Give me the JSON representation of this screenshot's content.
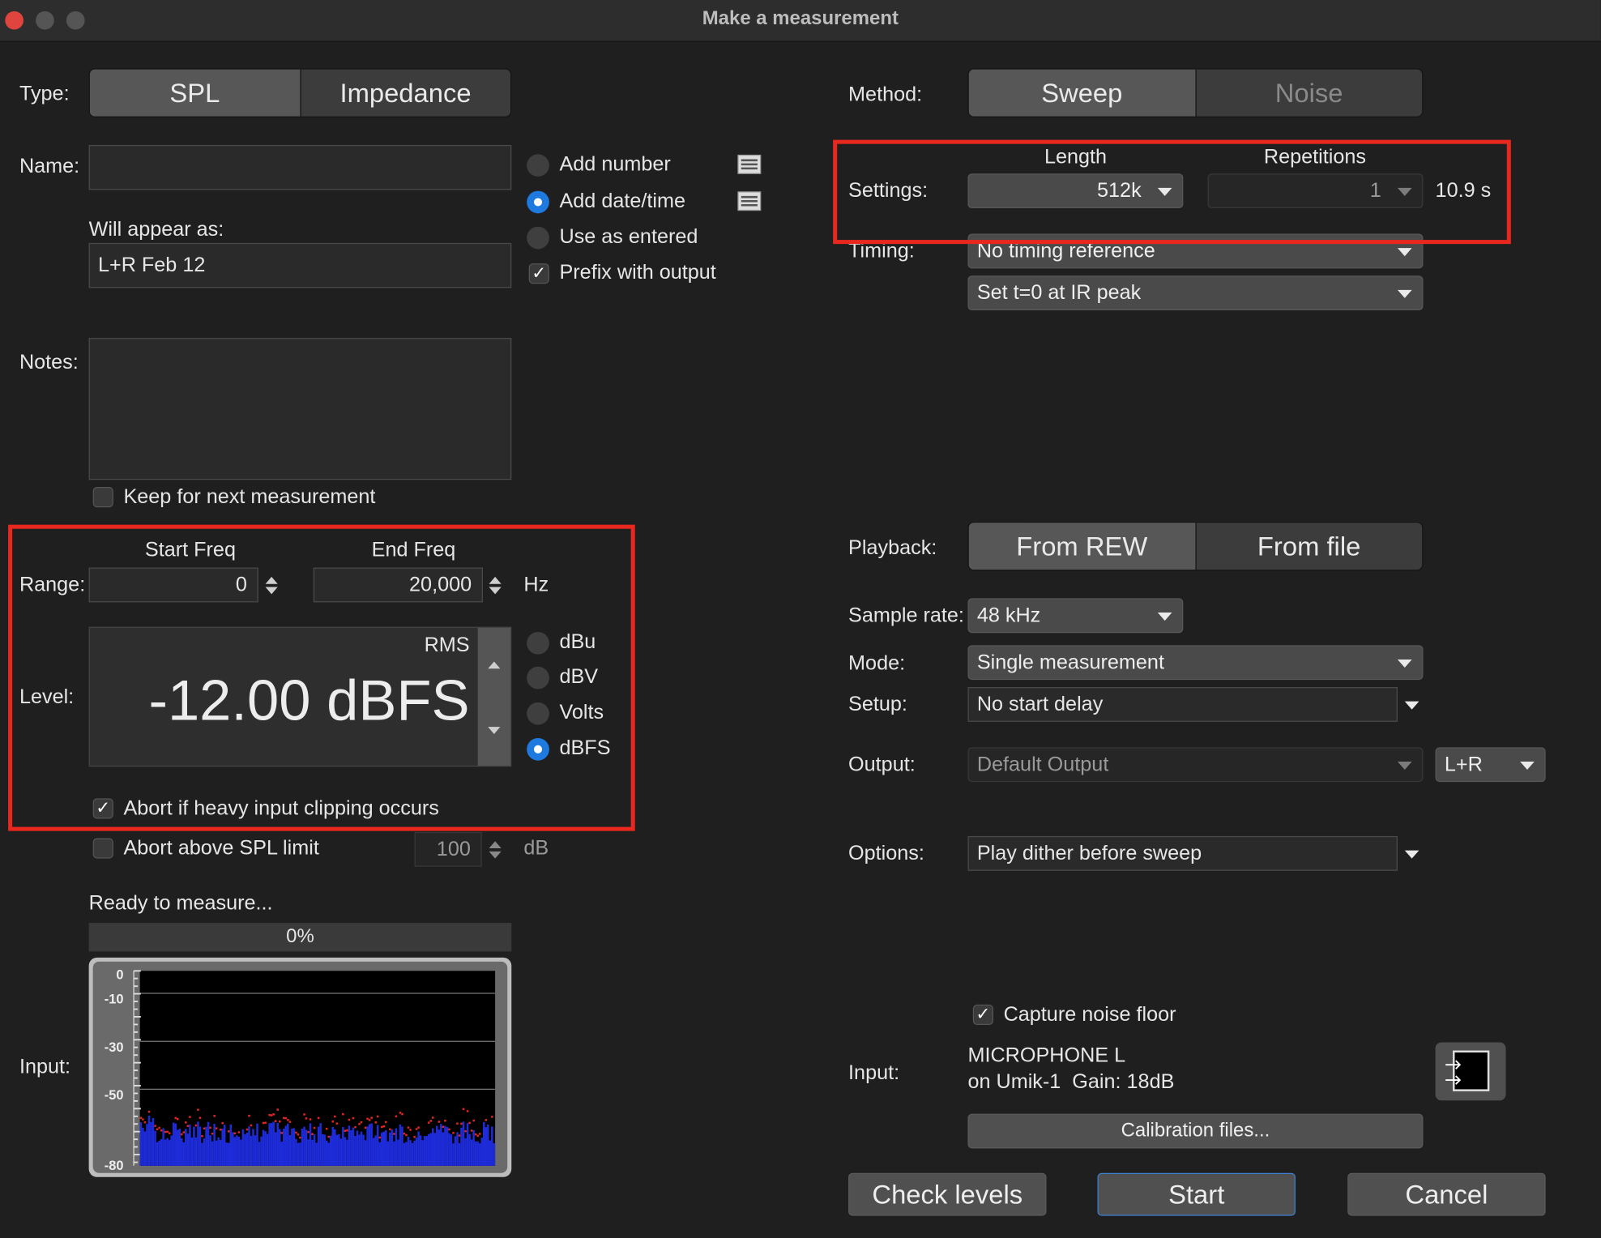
{
  "window": {
    "title": "Make a measurement"
  },
  "type": {
    "label": "Type:",
    "options": [
      "SPL",
      "Impedance"
    ],
    "selected": "SPL"
  },
  "name": {
    "label": "Name:",
    "value": "",
    "appear_label": "Will appear as:",
    "appear_value": "L+R Feb 12"
  },
  "naming_options": [
    "Add number",
    "Add date/time",
    "Use as entered",
    "Prefix with output"
  ],
  "naming_selected": "Add date/time",
  "notes": {
    "label": "Notes:",
    "value": "",
    "keep_label": "Keep for next measurement"
  },
  "range": {
    "label": "Range:",
    "start_label": "Start Freq",
    "end_label": "End Freq",
    "start": "0",
    "end": "20,000",
    "unit": "Hz"
  },
  "level": {
    "label": "Level:",
    "mode": "RMS",
    "value": "-12.00 dBFS",
    "units": [
      "dBu",
      "dBV",
      "Volts",
      "dBFS"
    ],
    "selected_unit": "dBFS"
  },
  "abort_clipping": {
    "label": "Abort if heavy input clipping occurs",
    "checked": true
  },
  "abort_spl": {
    "label": "Abort above SPL limit",
    "checked": false,
    "value": "100",
    "unit": "dB"
  },
  "status": {
    "text": "Ready to measure...",
    "progress": "0%"
  },
  "input_meter": {
    "label": "Input:",
    "ticks": [
      "0",
      "-10",
      "-30",
      "-50",
      "-80"
    ]
  },
  "method": {
    "label": "Method:",
    "options": [
      "Sweep",
      "Noise"
    ],
    "selected": "Sweep"
  },
  "settings": {
    "label": "Settings:",
    "length_label": "Length",
    "length": "512k",
    "reps_label": "Repetitions",
    "reps": "1",
    "duration": "10.9 s"
  },
  "timing": {
    "label": "Timing:",
    "reference": "No timing reference",
    "ir_peak": "Set t=0 at IR peak"
  },
  "playback": {
    "label": "Playback:",
    "options": [
      "From REW",
      "From file"
    ],
    "selected": "From REW"
  },
  "sample_rate": {
    "label": "Sample rate:",
    "value": "48 kHz"
  },
  "mode": {
    "label": "Mode:",
    "value": "Single measurement"
  },
  "setup": {
    "label": "Setup:",
    "value": "No start delay"
  },
  "output": {
    "label": "Output:",
    "device": "Default Output",
    "channel": "L+R"
  },
  "options": {
    "label": "Options:",
    "value": "Play dither before sweep"
  },
  "capture_noise": {
    "label": "Capture noise floor",
    "checked": true
  },
  "input_device": {
    "label": "Input:",
    "line1": "MICROPHONE L",
    "line2": "on Umik-1  Gain: 18dB"
  },
  "buttons": {
    "calibration": "Calibration files...",
    "check_levels": "Check levels",
    "start": "Start",
    "cancel": "Cancel"
  },
  "colors": {
    "highlight": "#e8281f",
    "radio_on": "#1f7ae0",
    "meter_bars": "#1d2bd8",
    "meter_peaks": "#e0261f"
  }
}
